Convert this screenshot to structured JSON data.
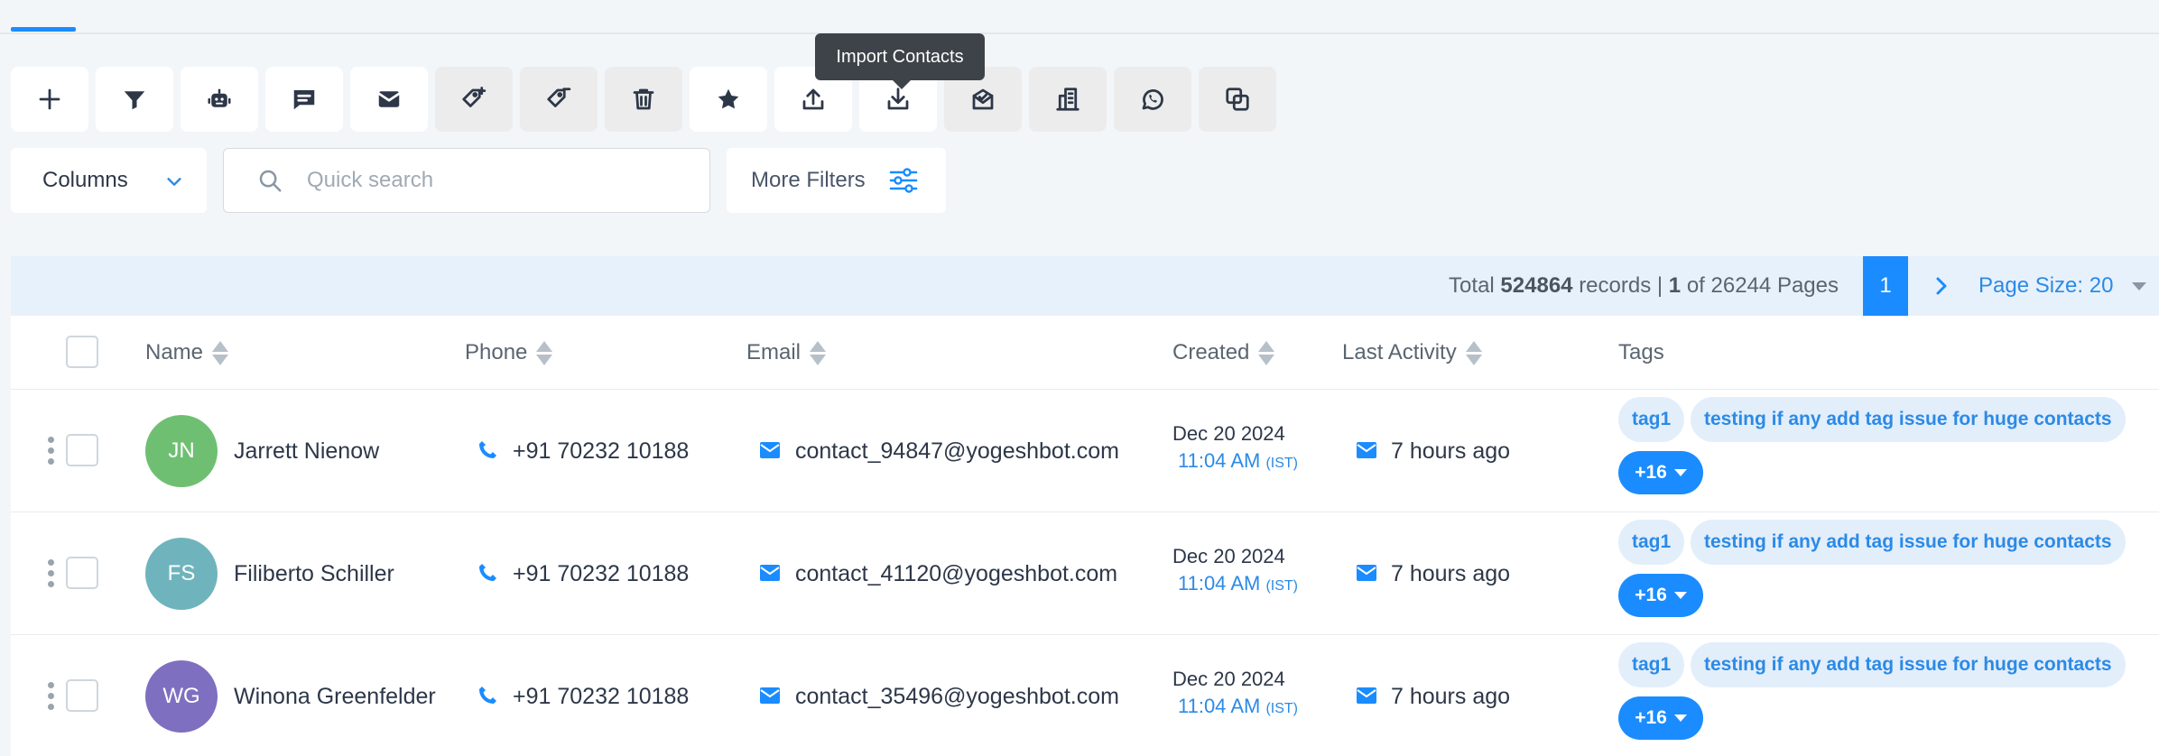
{
  "tooltip": "Import Contacts",
  "toolbar": [
    {
      "name": "add-contact-button",
      "icon": "plus-icon"
    },
    {
      "name": "filter-button",
      "icon": "filter-icon"
    },
    {
      "name": "bot-button",
      "icon": "robot-icon"
    },
    {
      "name": "message-button",
      "icon": "chat-icon"
    },
    {
      "name": "email-button",
      "icon": "envelope-icon"
    },
    {
      "name": "add-tag-button",
      "icon": "tag-plus-icon"
    },
    {
      "name": "remove-tag-button",
      "icon": "tag-minus-icon"
    },
    {
      "name": "delete-button",
      "icon": "trash-icon"
    },
    {
      "name": "star-button",
      "icon": "star-icon"
    },
    {
      "name": "export-button",
      "icon": "upload-icon"
    },
    {
      "name": "import-contacts-button",
      "icon": "download-icon"
    },
    {
      "name": "mail-campaign-button",
      "icon": "mail-open-icon"
    },
    {
      "name": "company-button",
      "icon": "building-icon"
    },
    {
      "name": "whatsapp-button",
      "icon": "whatsapp-icon"
    },
    {
      "name": "duplicate-button",
      "icon": "copy-icon"
    }
  ],
  "filters": {
    "columns_label": "Columns",
    "search_placeholder": "Quick search",
    "more_filters_label": "More Filters"
  },
  "pagination": {
    "total_prefix": "Total",
    "total_records": "524864",
    "records_label": "records |",
    "current_page": "1",
    "of_label": "of",
    "total_pages": "26244",
    "pages_label": "Pages",
    "page_size": "Page Size: 20"
  },
  "columns": {
    "name": "Name",
    "phone": "Phone",
    "email": "Email",
    "created": "Created",
    "last_activity": "Last Activity",
    "tags": "Tags"
  },
  "rows": [
    {
      "initials": "JN",
      "avatar_color": "#6fbf73",
      "name": "Jarrett Nienow",
      "phone": "+91 70232 10188",
      "email": "contact_94847@yogeshbot.com",
      "created_date": "Dec 20 2024",
      "created_time": "11:04 AM",
      "tz": "(IST)",
      "last_activity": "7 hours ago",
      "tag1": "tag1",
      "tag2": "testing if any add tag issue for huge contacts",
      "more": "+16"
    },
    {
      "initials": "FS",
      "avatar_color": "#6fb4bd",
      "name": "Filiberto Schiller",
      "phone": "+91 70232 10188",
      "email": "contact_41120@yogeshbot.com",
      "created_date": "Dec 20 2024",
      "created_time": "11:04 AM",
      "tz": "(IST)",
      "last_activity": "7 hours ago",
      "tag1": "tag1",
      "tag2": "testing if any add tag issue for huge contacts",
      "more": "+16"
    },
    {
      "initials": "WG",
      "avatar_color": "#7f6fc0",
      "name": "Winona Greenfelder",
      "phone": "+91 70232 10188",
      "email": "contact_35496@yogeshbot.com",
      "created_date": "Dec 20 2024",
      "created_time": "11:04 AM",
      "tz": "(IST)",
      "last_activity": "7 hours ago",
      "tag1": "tag1",
      "tag2": "testing if any add tag issue for huge contacts",
      "more": "+16"
    }
  ],
  "colors": {
    "accent": "#1a8cff",
    "link": "#2b8ae6",
    "tag_bg": "#e3eefb"
  }
}
